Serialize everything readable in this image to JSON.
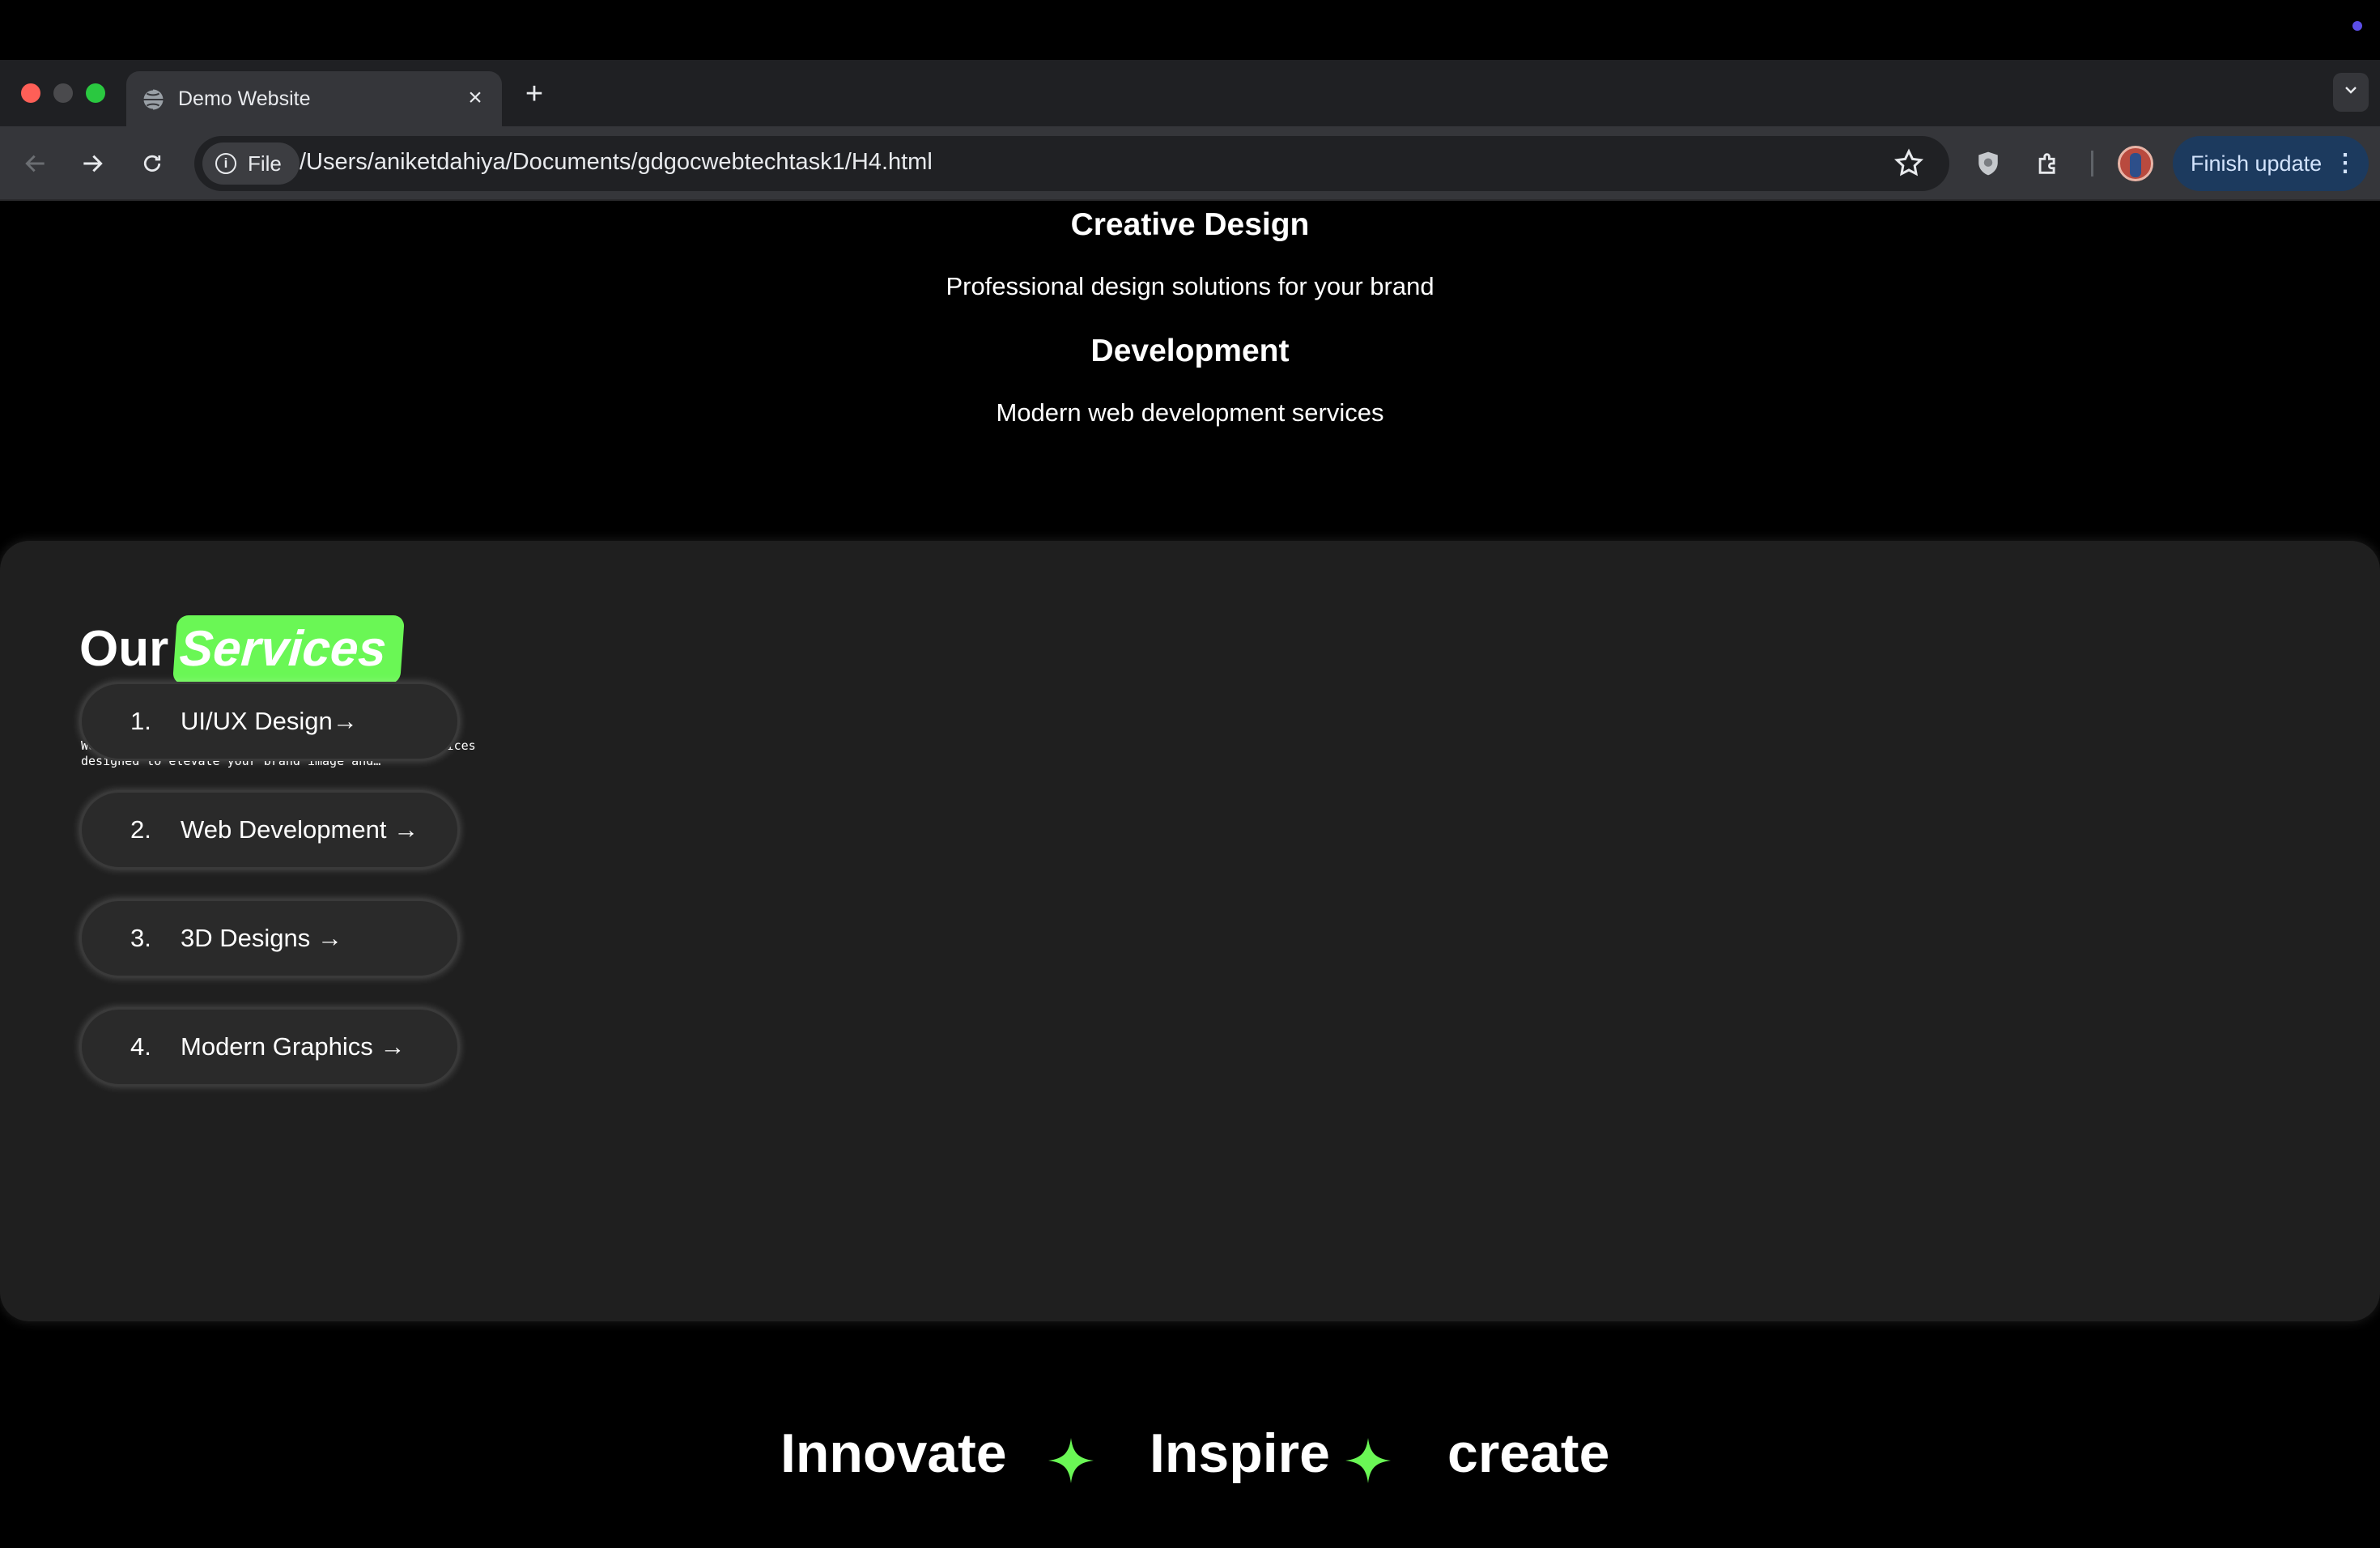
{
  "browser": {
    "tab_title": "Demo Website",
    "url_scheme_label": "File",
    "url": "/Users/aniketdahiya/Documents/gdgocwebtechtask1/H4.html",
    "finish_update_label": "Finish update"
  },
  "page": {
    "services_top": [
      {
        "title": "Creative Design",
        "text": "Professional design solutions for your brand"
      },
      {
        "title": "Development",
        "text": "Modern web development services"
      }
    ],
    "services_section": {
      "title_plain": "Our",
      "title_highlight": "Services",
      "description": "We offer a range of powerful, creative design services designed to elevate your brand image and…",
      "items": [
        {
          "number": "1.",
          "label": "UI/UX Design→"
        },
        {
          "number": "2.",
          "label": "Web Development →"
        },
        {
          "number": "3.",
          "label": "3D Designs →"
        },
        {
          "number": "4.",
          "label": "Modern Graphics →"
        }
      ],
      "accent_color": "#6af755"
    },
    "marquee": {
      "words": [
        "Innovate",
        "Inspire",
        "create"
      ],
      "separator_icon": "four-point-star-icon"
    }
  }
}
